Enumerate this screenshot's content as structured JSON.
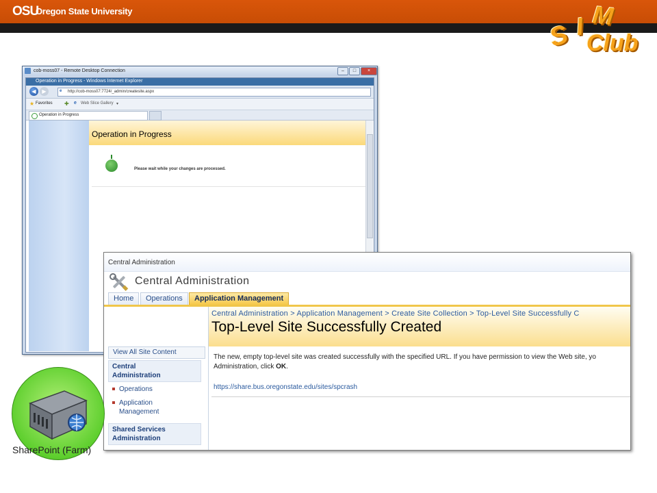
{
  "header": {
    "osu_mark": "OSU",
    "university_name": "Oregon State University"
  },
  "club_logo": {
    "letter_s": "S",
    "letter_i": "I",
    "letter_m": "M",
    "club": "Club",
    "color": "#f6a21a"
  },
  "rdp": {
    "title": "cob-moss07 - Remote Desktop Connection",
    "ie": {
      "title": "Operation in Progress - Windows Internet Explorer",
      "address": "http://cob-moss07:7724/_admin/createsite.aspx",
      "favorites_label": "Favorites",
      "web_slice_label": "Web Slice Gallery",
      "tab_label": "Operation in Progress",
      "page_heading": "Operation in Progress",
      "page_message": "Please wait while your changes are processed."
    }
  },
  "sharepoint": {
    "site_name": "Central Administration",
    "app_title": "Central Administration",
    "tabs": [
      {
        "label": "Home"
      },
      {
        "label": "Operations"
      },
      {
        "label": "Application Management"
      }
    ],
    "breadcrumb": "Central Administration > Application Management > Create Site Collection > Top-Level Site Successfully C",
    "page_title": "Top-Level Site Successfully Created",
    "description_line1": "The new, empty top-level site was created successfully with the specified URL. If you have permission to view the Web site, yo",
    "description_line2_prefix": "Administration, click ",
    "description_line2_bold": "OK",
    "description_line2_suffix": ".",
    "site_url": "https://share.bus.oregonstate.edu/sites/spcrash",
    "left_nav": {
      "view_all": "View All Site Content",
      "central_heading_line1": "Central",
      "central_heading_line2": "Administration",
      "items": [
        {
          "label": "Operations"
        },
        {
          "label_line1": "Application",
          "label_line2": "Management"
        }
      ],
      "shared_heading_line1": "Shared Services",
      "shared_heading_line2": "Administration"
    }
  },
  "farm_badge": {
    "label": "SharePoint (Farm)"
  },
  "colors": {
    "osu_orange": "#d35400",
    "sharepoint_gold": "#f0c64a",
    "link_blue": "#2a5a9e"
  }
}
